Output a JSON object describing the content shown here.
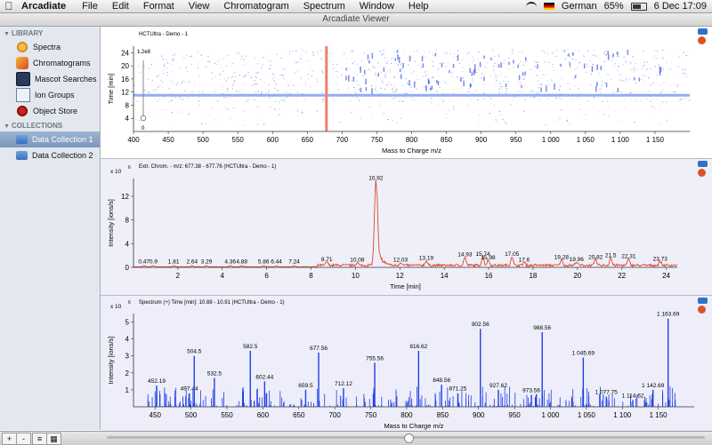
{
  "menubar": {
    "apple": "",
    "app_name": "Arcadiate",
    "menus": [
      "File",
      "Edit",
      "Format",
      "View",
      "Chromatogram",
      "Spectrum",
      "Window",
      "Help"
    ],
    "status": {
      "language": "German",
      "battery": "65%",
      "battery_level": 0.65,
      "datetime": "6 Dec  17:09"
    }
  },
  "window": {
    "title": "Arcadiate Viewer"
  },
  "sidebar": {
    "library_label": "LIBRARY",
    "library_items": [
      {
        "label": "Spectra",
        "icon": "spectra-icon"
      },
      {
        "label": "Chromatograms",
        "icon": "chromatogram-icon"
      },
      {
        "label": "Mascot Searches",
        "icon": "mascot-icon"
      },
      {
        "label": "Ion Groups",
        "icon": "ion-groups-icon"
      },
      {
        "label": "Object Store",
        "icon": "object-store-icon"
      }
    ],
    "collections_label": "COLLECTIONS",
    "collection_items": [
      {
        "label": "Data Collection 1",
        "selected": true
      },
      {
        "label": "Data Collection 2",
        "selected": false
      }
    ]
  },
  "colors": {
    "map_points": "#2a3ce0",
    "selection": "#f08070",
    "chrom_line": "#e0472a",
    "spectrum_line": "#1f3fe0",
    "hline": "#7f9ff5"
  },
  "chart_data": [
    {
      "type": "heatmap",
      "title": "HCTUltra - Demo - 1",
      "xlabel": "Mass to Charge m/z",
      "ylabel": "Time [min]",
      "xlim": [
        400,
        1200
      ],
      "ylim": [
        0,
        26
      ],
      "xticks": [
        400,
        450,
        500,
        550,
        600,
        650,
        700,
        750,
        800,
        850,
        900,
        950,
        1000,
        1050,
        1100,
        1150
      ],
      "xtick_labels": [
        "400",
        "450",
        "500",
        "550",
        "600",
        "650",
        "700",
        "750",
        "800",
        "850",
        "900",
        "950",
        "1 000",
        "1 050",
        "1 100",
        "1 150"
      ],
      "yticks": [
        4,
        8,
        12,
        16,
        20,
        24
      ],
      "intensity_scale": {
        "max_label": "1.2e8",
        "min_label": "0"
      },
      "selected_mz": 677.5,
      "selected_time": 10.9
    },
    {
      "type": "line",
      "title": "Extr. Chrom. - m/z: 677.38 - 677.76 (HCTUltra - Demo - 1)",
      "xlabel": "Time [min]",
      "ylabel": "Intensity [ions/s]",
      "y_exponent": "x 10",
      "y_exponent_power": "6",
      "xlim": [
        0,
        24.5
      ],
      "ylim": [
        0,
        15
      ],
      "xticks": [
        2,
        4,
        6,
        8,
        10,
        12,
        14,
        16,
        18,
        20,
        22,
        24
      ],
      "yticks": [
        0,
        4,
        8,
        12
      ],
      "peak_labels": [
        {
          "x": 0.47,
          "label": "0.47"
        },
        {
          "x": 0.9,
          "label": "0.9"
        },
        {
          "x": 1.81,
          "label": "1.81"
        },
        {
          "x": 2.64,
          "label": "2.64"
        },
        {
          "x": 3.29,
          "label": "3.29"
        },
        {
          "x": 4.36,
          "label": "4.36"
        },
        {
          "x": 4.88,
          "label": "4.88"
        },
        {
          "x": 5.86,
          "label": "5.86"
        },
        {
          "x": 6.44,
          "label": "6.44"
        },
        {
          "x": 7.24,
          "label": "7.24"
        },
        {
          "x": 8.71,
          "label": "8.71"
        },
        {
          "x": 10.08,
          "label": "10.08"
        },
        {
          "x": 10.92,
          "label": "10.92"
        },
        {
          "x": 12.03,
          "label": "12.03"
        },
        {
          "x": 13.19,
          "label": "13.19"
        },
        {
          "x": 14.93,
          "label": "14.93"
        },
        {
          "x": 15.74,
          "label": "15.74"
        },
        {
          "x": 15.98,
          "label": "15.98"
        },
        {
          "x": 17.05,
          "label": "17.05"
        },
        {
          "x": 17.6,
          "label": "17.6"
        },
        {
          "x": 19.28,
          "label": "19.28"
        },
        {
          "x": 19.96,
          "label": "19.96"
        },
        {
          "x": 20.82,
          "label": "20.82"
        },
        {
          "x": 21.5,
          "label": "21.5"
        },
        {
          "x": 22.31,
          "label": "22.31"
        },
        {
          "x": 23.73,
          "label": "23.73"
        }
      ],
      "peak_values": [
        0.2,
        0.2,
        0.2,
        0.2,
        0.2,
        0.2,
        0.2,
        0.2,
        0.2,
        0.2,
        0.6,
        0.5,
        14.3,
        0.5,
        0.8,
        1.4,
        1.5,
        0.9,
        1.5,
        0.5,
        1.0,
        0.6,
        1.0,
        1.3,
        1.1,
        0.7
      ]
    },
    {
      "type": "bar",
      "title": "Spectrum (+) Time [min]: 10.88 - 10.91 (HCTUltra - Demo - 1)",
      "xlabel": "Mass to Charge m/z",
      "ylabel": "Intensity [ions/s]",
      "y_exponent": "x 10",
      "y_exponent_power": "6",
      "xlim": [
        420,
        1200
      ],
      "ylim": [
        0,
        5.5
      ],
      "xticks": [
        450,
        500,
        550,
        600,
        650,
        700,
        750,
        800,
        850,
        900,
        950,
        1000,
        1050,
        1100,
        1150
      ],
      "xtick_labels": [
        "450",
        "500",
        "550",
        "600",
        "650",
        "700",
        "750",
        "800",
        "850",
        "900",
        "950",
        "1 000",
        "1 050",
        "1 100",
        "1 150"
      ],
      "yticks": [
        1,
        2,
        3,
        4,
        5
      ],
      "peaks": [
        {
          "mz": 452.19,
          "value": 1.25,
          "label": "452.19"
        },
        {
          "mz": 497.44,
          "value": 0.8,
          "label": "497.44"
        },
        {
          "mz": 504.5,
          "value": 3.0,
          "label": "504.5"
        },
        {
          "mz": 532.5,
          "value": 1.7,
          "label": "532.5"
        },
        {
          "mz": 582.5,
          "value": 3.3,
          "label": "582.5"
        },
        {
          "mz": 602.44,
          "value": 1.5,
          "label": "602.44"
        },
        {
          "mz": 659.5,
          "value": 1.0,
          "label": "659.5"
        },
        {
          "mz": 677.56,
          "value": 3.2,
          "label": "677.56"
        },
        {
          "mz": 712.12,
          "value": 1.1,
          "label": "712.12"
        },
        {
          "mz": 755.56,
          "value": 2.6,
          "label": "755.56"
        },
        {
          "mz": 816.62,
          "value": 3.3,
          "label": "816.62"
        },
        {
          "mz": 848.56,
          "value": 1.3,
          "label": "848.56"
        },
        {
          "mz": 871.25,
          "value": 0.8,
          "label": "871.25"
        },
        {
          "mz": 902.56,
          "value": 4.6,
          "label": "902.56"
        },
        {
          "mz": 927.62,
          "value": 1.0,
          "label": "927.62"
        },
        {
          "mz": 973.56,
          "value": 0.7,
          "label": "973.56"
        },
        {
          "mz": 988.56,
          "value": 4.4,
          "label": "988.56"
        },
        {
          "mz": 1045.69,
          "value": 2.9,
          "label": "1 045.69"
        },
        {
          "mz": 1077.75,
          "value": 0.6,
          "label": "1 077.75"
        },
        {
          "mz": 1114.62,
          "value": 0.4,
          "label": "1 114.62"
        },
        {
          "mz": 1142.69,
          "value": 1.0,
          "label": "1 142.69"
        },
        {
          "mz": 1163.69,
          "value": 5.2,
          "label": "1 163.69"
        }
      ]
    }
  ]
}
